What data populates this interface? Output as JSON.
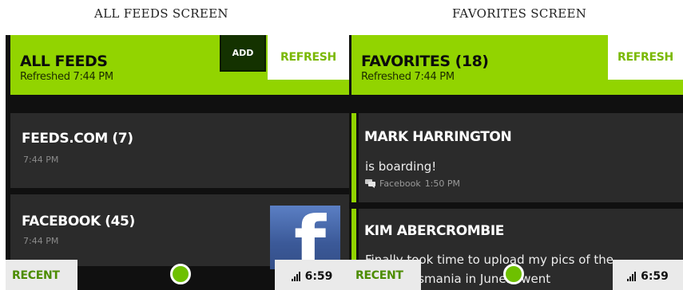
{
  "captions": {
    "left": "ALL FEEDS SCREEN",
    "right": "FAVORITES SCREEN"
  },
  "left": {
    "title": "ALL FEEDS",
    "subtitle": "Refreshed 7:44 PM",
    "add_label": "ADD",
    "refresh_label": "REFRESH",
    "feeds": [
      {
        "title": "FEEDS.COM (7)",
        "time": "7:44 PM"
      },
      {
        "title": "FACEBOOK (45)",
        "time": "7:44 PM",
        "logo": "facebook-logo"
      }
    ],
    "recent_label": "RECENT",
    "clock": "6:59"
  },
  "right": {
    "title": "FAVORITES (18)",
    "subtitle": "Refreshed 7:44 PM",
    "refresh_label": "REFRESH",
    "favorites": [
      {
        "name": "MARK HARRINGTON",
        "message": "is boarding!",
        "source": "Facebook",
        "time": "1:50 PM"
      },
      {
        "name": "KIM ABERCROMBIE",
        "message_line1": "Finally took time to upload my pics of the",
        "message_line2": "trip to Tasmania in June. I went"
      }
    ],
    "recent_label": "RECENT",
    "clock": "6:59"
  },
  "colors": {
    "accent": "#92d400",
    "card": "#2b2b2b",
    "background": "#101010",
    "facebook": "#3b5998"
  },
  "icons": {
    "signal": "signal-bars-icon",
    "comment": "comment-icon",
    "home": "home-dot-icon"
  }
}
